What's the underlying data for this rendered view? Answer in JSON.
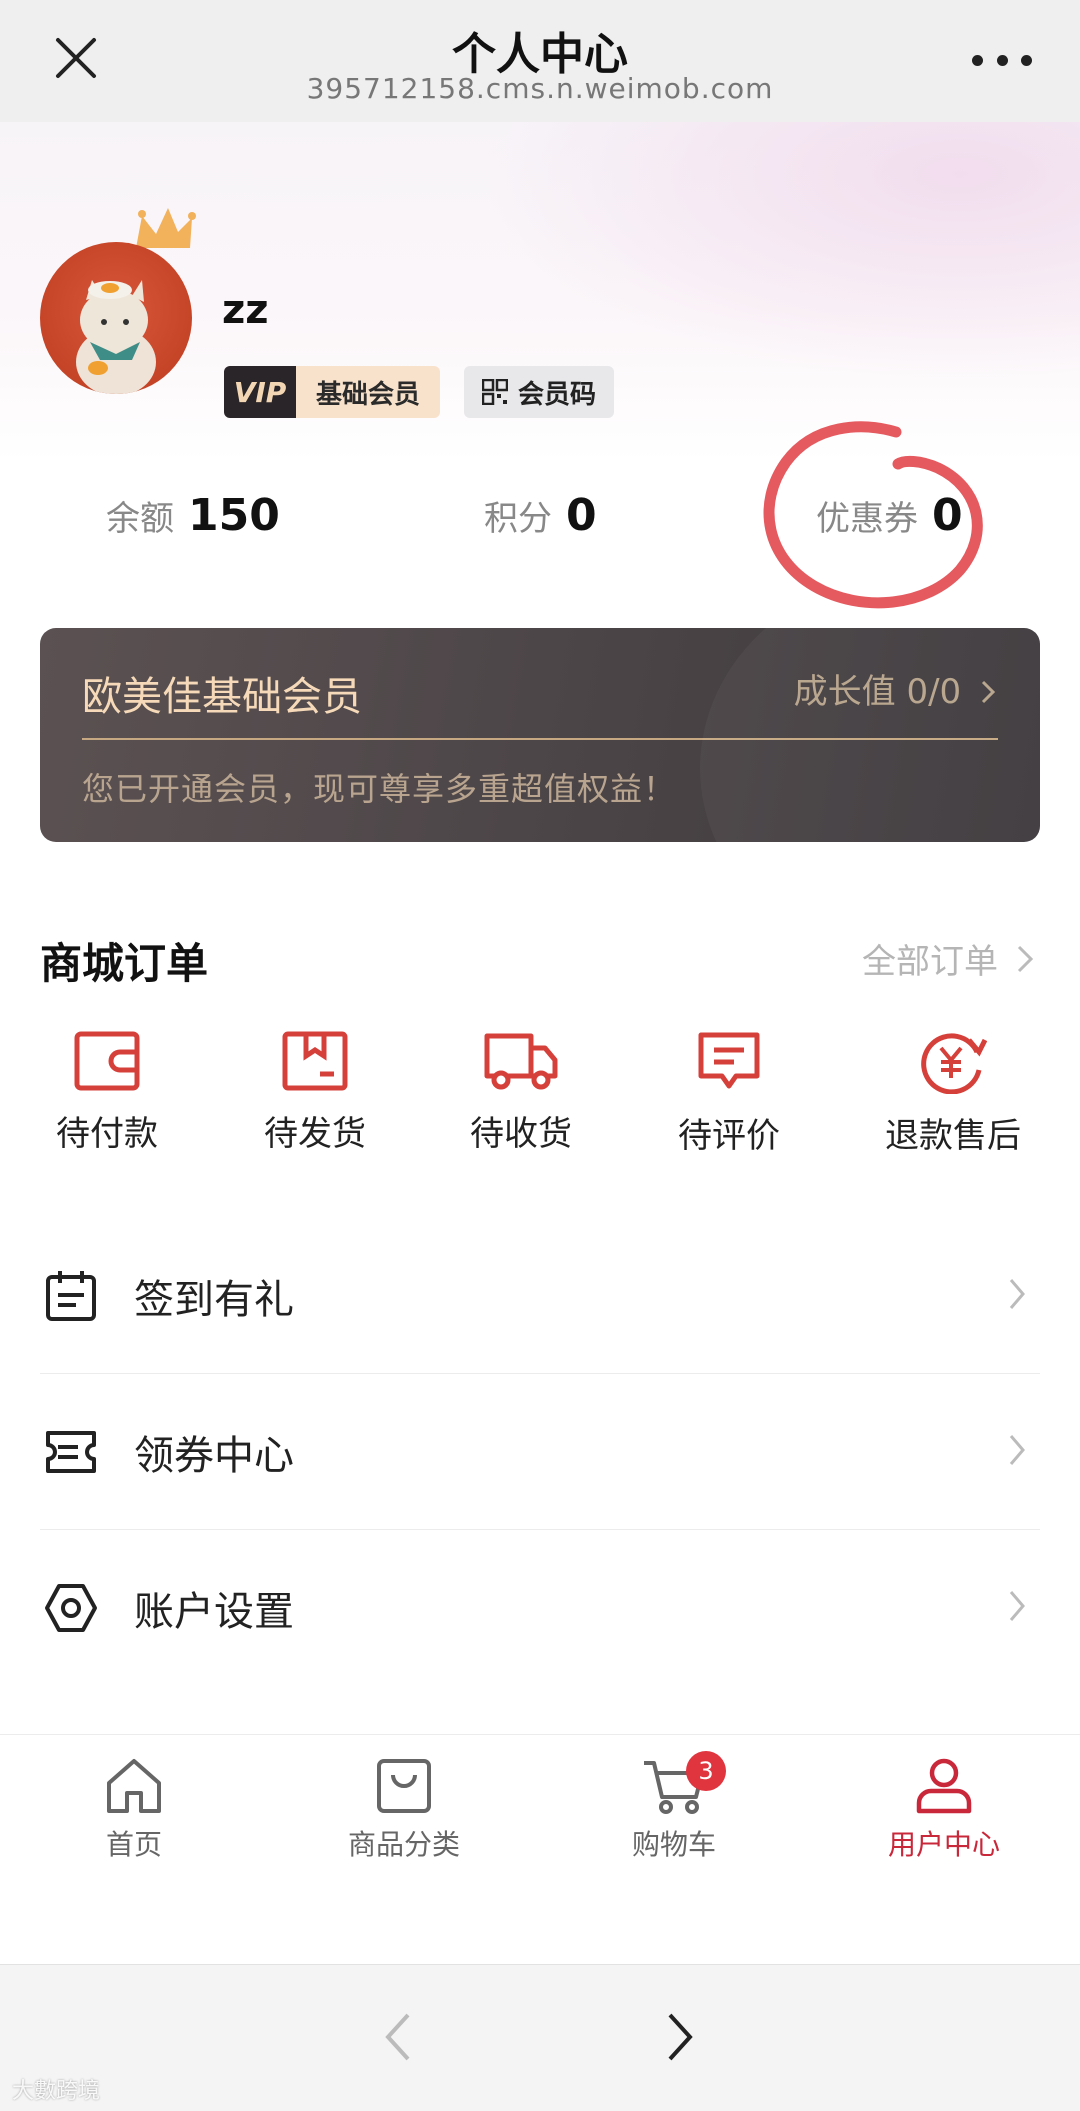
{
  "nav": {
    "title": "个人中心",
    "subtitle": "395712158.cms.n.weimob.com",
    "close_icon": "close-icon",
    "more_icon": "more-dots-icon"
  },
  "profile": {
    "username": "zz",
    "vip_mark": "VIP",
    "vip_level": "基础会员",
    "member_code": "会员码"
  },
  "stats": {
    "balance_label": "余额",
    "balance_value": "150",
    "points_label": "积分",
    "points_value": "0",
    "coupons_label": "优惠券",
    "coupons_value": "0"
  },
  "member_card": {
    "title": "欧美佳基础会员",
    "growth": "成长值 0/0",
    "description": "您已开通会员，现可尊享多重超值权益！"
  },
  "orders": {
    "title": "商城订单",
    "all_label": "全部订单",
    "items": [
      {
        "label": "待付款",
        "icon": "wallet-icon"
      },
      {
        "label": "待发货",
        "icon": "package-icon"
      },
      {
        "label": "待收货",
        "icon": "truck-icon"
      },
      {
        "label": "待评价",
        "icon": "comment-icon"
      },
      {
        "label": "退款售后",
        "icon": "refund-icon"
      }
    ]
  },
  "menu": [
    {
      "label": "签到有礼",
      "icon": "calendar-icon"
    },
    {
      "label": "领券中心",
      "icon": "ticket-icon"
    },
    {
      "label": "账户设置",
      "icon": "settings-icon"
    }
  ],
  "tabbar": {
    "items": [
      {
        "label": "首页",
        "icon": "home-icon"
      },
      {
        "label": "商品分类",
        "icon": "bag-icon"
      },
      {
        "label": "购物车",
        "icon": "cart-icon",
        "badge": "3"
      },
      {
        "label": "用户中心",
        "icon": "user-icon",
        "active": true
      }
    ]
  },
  "browser": {
    "back_icon": "back-arrow-icon",
    "forward_icon": "forward-arrow-icon",
    "watermark": "大數跨境"
  },
  "colors": {
    "accent": "#c9283a",
    "card_bg": "#4e4749",
    "gold": "#f5d9b8",
    "badge": "#e0343f"
  }
}
